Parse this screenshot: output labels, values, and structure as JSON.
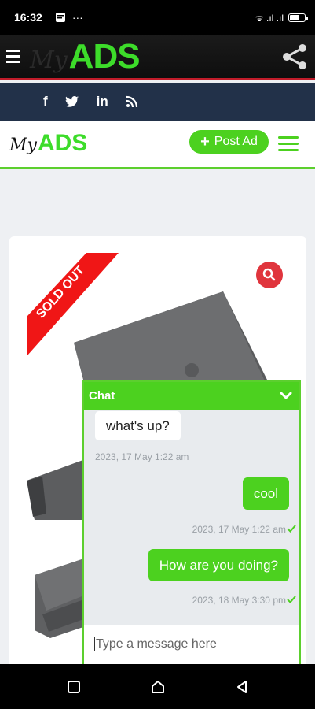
{
  "status_bar": {
    "time": "16:32",
    "dots": "···",
    "signal_text": "ᯤ .ıl .ıl"
  },
  "top_bar": {
    "brand_my": "My",
    "brand_ads": "ADS"
  },
  "social": {
    "facebook": "f",
    "twitter": "🐦",
    "linkedin": "in",
    "rss": "RSS"
  },
  "site_header": {
    "logo_my": "My",
    "logo_ads": "ADS",
    "post_ad_plus": "+",
    "post_ad_label": "Post Ad"
  },
  "card": {
    "ribbon_text": "SOLD OUT"
  },
  "chat": {
    "title": "Chat",
    "messages": [
      {
        "direction": "in",
        "text": "what's up?",
        "timestamp": "2023, 17 May 1:22 am"
      },
      {
        "direction": "out",
        "text": "cool",
        "timestamp": "2023, 17 May 1:22 am"
      },
      {
        "direction": "out",
        "text": "How are you doing?",
        "timestamp": "2023, 18 May 3:30 pm"
      }
    ],
    "input_placeholder": "Type a message here"
  },
  "colors": {
    "brand_green": "#4cd11f",
    "accent_red": "#e0353d",
    "social_bar": "#223149"
  },
  "icons": [
    "menu-icon",
    "share-icon",
    "facebook-icon",
    "twitter-icon",
    "linkedin-icon",
    "rss-icon",
    "search-icon",
    "chevron-down-icon",
    "check-icon",
    "nav-recents-icon",
    "nav-home-icon",
    "nav-back-icon"
  ]
}
